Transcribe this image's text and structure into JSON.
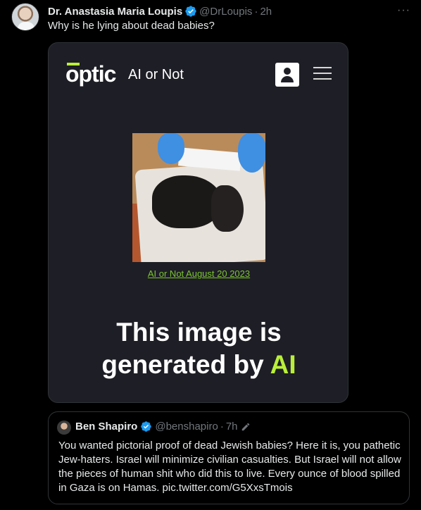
{
  "tweet": {
    "author_name": "Dr. Anastasia Maria Loupis",
    "author_handle": "@DrLoupis",
    "separator": "·",
    "time": "2h",
    "text": "Why is he lying about dead babies?",
    "more": "···"
  },
  "media": {
    "logo": "optic",
    "product": "AI or Not",
    "link_text": "AI or Not August 20 2023",
    "result_line1": "This image is",
    "result_line2_prefix": "generated by",
    "result_line2_accent": "AI",
    "accent_color": "#b9ef3a",
    "link_color": "#7bc42e"
  },
  "quote": {
    "author_name": "Ben Shapiro",
    "author_handle": "@benshapiro",
    "separator": "·",
    "time": "7h",
    "text": "You wanted pictorial proof of dead Jewish babies? Here it is, you pathetic Jew-haters. Israel will minimize civilian casualties. But Israel will not allow the pieces of human shit who did this to live. Every ounce of blood spilled in Gaza is on Hamas. pic.twitter.com/G5XxsTmois"
  },
  "colors": {
    "verified_blue": "#1d9bf0",
    "muted_text": "#71767b",
    "border": "#2f3336"
  },
  "icons": [
    "more-options-icon",
    "verified-badge-icon",
    "user-account-icon",
    "hamburger-menu-icon",
    "edit-pencil-icon"
  ]
}
